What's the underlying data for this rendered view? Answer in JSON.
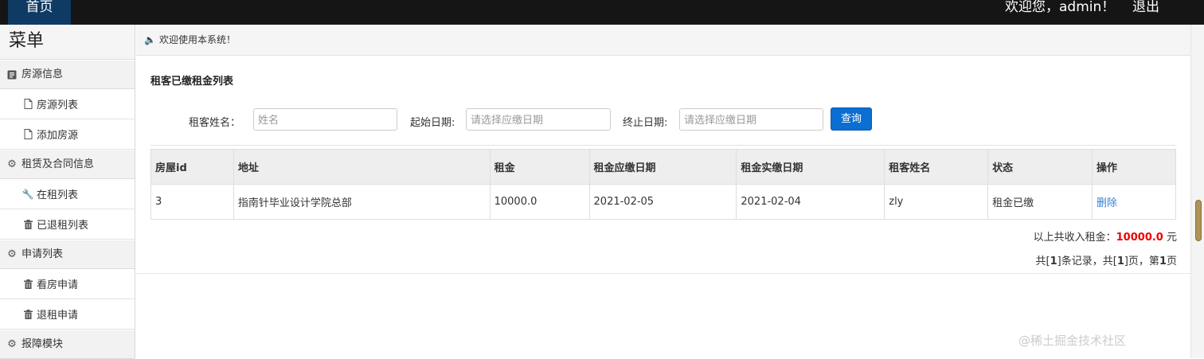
{
  "topbar": {
    "home_label": "首页",
    "welcome_text": "欢迎您，admin！",
    "logout_label": "退出",
    "background_color": "#151515",
    "home_tab_color": "#0e3a63"
  },
  "sidebar": {
    "title": "菜单",
    "groups": [
      {
        "label": "房源信息",
        "icon": "document-icon",
        "items": [
          {
            "label": "房源列表",
            "icon": "file-icon"
          },
          {
            "label": "添加房源",
            "icon": "file-icon"
          }
        ]
      },
      {
        "label": "租赁及合同信息",
        "icon": "gear-icon",
        "items": [
          {
            "label": "在租列表",
            "icon": "wrench-icon"
          },
          {
            "label": "已退租列表",
            "icon": "trash-icon"
          }
        ]
      },
      {
        "label": "申请列表",
        "icon": "gear-icon",
        "items": [
          {
            "label": "看房申请",
            "icon": "trash-icon"
          },
          {
            "label": "退租申请",
            "icon": "trash-icon"
          }
        ]
      },
      {
        "label": "报障模块",
        "icon": "gear-icon",
        "items": []
      }
    ]
  },
  "main": {
    "notice": "欢迎使用本系统！",
    "list_title": "租客已缴租金列表",
    "filters": {
      "tenant_label": "租客姓名：",
      "tenant_placeholder": "姓名",
      "start_label": "起始日期:",
      "start_placeholder": "请选择应缴日期",
      "end_label": "终止日期:",
      "end_placeholder": "请选择应缴日期",
      "query_label": "查询"
    },
    "table": {
      "headers": [
        "房屋id",
        "地址",
        "租金",
        "租金应缴日期",
        "租金实缴日期",
        "租客姓名",
        "状态",
        "操作"
      ],
      "rows": [
        {
          "house_id": "3",
          "address": "指南针毕业设计学院总部",
          "rent": "10000.0",
          "due_date": "2021-02-05",
          "paid_date": "2021-02-04",
          "tenant": "zly",
          "status": "租金已缴",
          "action": "删除"
        }
      ]
    },
    "summary": {
      "prefix": "以上共收入租金：",
      "amount": "10000.0",
      "suffix": " 元"
    },
    "pager": {
      "p1": "共[",
      "total": "1",
      "p2": "]条记录，共[",
      "pages": "1",
      "p3": "]页，第",
      "current": "1",
      "p4": "页"
    }
  },
  "watermark": "@稀土掘金技术社区",
  "colors": {
    "accent": "#0b6ed2",
    "amount": "#e00000",
    "link": "#3a7fd0"
  }
}
